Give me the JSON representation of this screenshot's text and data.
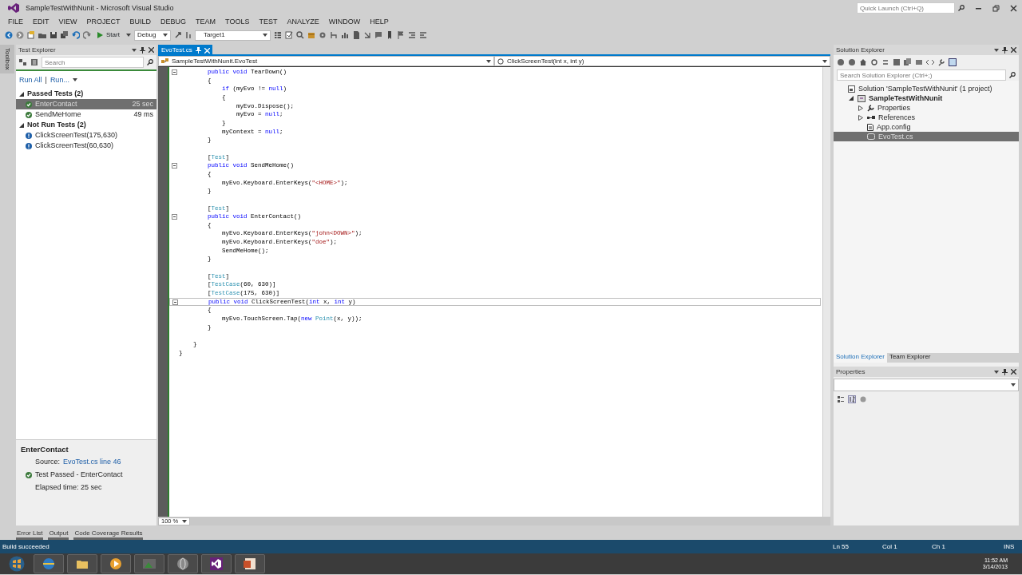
{
  "window": {
    "title": "SampleTestWithNunit - Microsoft Visual Studio",
    "quick_launch": {
      "placeholder": "Quick Launch (Ctrl+Q)"
    }
  },
  "menu": [
    "FILE",
    "EDIT",
    "VIEW",
    "PROJECT",
    "BUILD",
    "DEBUG",
    "TEAM",
    "TOOLS",
    "TEST",
    "ANALYZE",
    "WINDOW",
    "HELP"
  ],
  "toolbar": {
    "start_label": "Start",
    "configuration": "Debug",
    "target": "Target1"
  },
  "toolbox_tab": "Toolbox",
  "test_explorer": {
    "title": "Test Explorer",
    "search": {
      "placeholder": "Search"
    },
    "run_all": "Run All",
    "run_separator": "|",
    "run": "Run...",
    "groups": [
      {
        "label": "Passed Tests (2)",
        "expanded": true,
        "tests": [
          {
            "name": "EnterContact",
            "duration": "25 sec",
            "kind": "passed",
            "selected": true
          },
          {
            "name": "SendMeHome",
            "duration": "49 ms",
            "kind": "passed",
            "selected": false
          }
        ]
      },
      {
        "label": "Not Run Tests (2)",
        "expanded": true,
        "tests": [
          {
            "name": "ClickScreenTest(175,630)",
            "kind": "not_run",
            "selected": false
          },
          {
            "name": "ClickScreenTest(60,630)",
            "kind": "not_run",
            "selected": false
          }
        ]
      }
    ],
    "detail": {
      "title": "EnterContact",
      "source_label": "Source:",
      "source_link": "EvoTest.cs line 46",
      "result": "Test Passed - EnterContact",
      "kind": "passed",
      "elapsed": "Elapsed time: 25 sec"
    }
  },
  "editor": {
    "tabs": [
      {
        "label": "EvoTest.cs",
        "selected": true
      }
    ],
    "type_dropdown": "SampleTestWithNunit.EvoTest",
    "member_dropdown": "ClickScreenTest(int x, int y)",
    "zoom": "100 %",
    "code_lines": [
      {
        "kind": "code",
        "foldable": true,
        "segments": [
          {
            "text": "        public void",
            "kind": "keyword"
          },
          {
            "text": " TearDown()",
            "kind": "plain"
          }
        ]
      },
      {
        "kind": "code",
        "segments": [
          {
            "text": "        {",
            "kind": "plain"
          }
        ]
      },
      {
        "kind": "code",
        "segments": [
          {
            "text": "            if",
            "kind": "keyword"
          },
          {
            "text": " (myEvo != ",
            "kind": "plain"
          },
          {
            "text": "null",
            "kind": "keyword"
          },
          {
            "text": ")",
            "kind": "plain"
          }
        ]
      },
      {
        "kind": "code",
        "segments": [
          {
            "text": "            {",
            "kind": "plain"
          }
        ]
      },
      {
        "kind": "code",
        "segments": [
          {
            "text": "                myEvo.Dispose();",
            "kind": "plain"
          }
        ]
      },
      {
        "kind": "code",
        "segments": [
          {
            "text": "                myEvo = ",
            "kind": "plain"
          },
          {
            "text": "null",
            "kind": "keyword"
          },
          {
            "text": ";",
            "kind": "plain"
          }
        ]
      },
      {
        "kind": "code",
        "segments": [
          {
            "text": "            }",
            "kind": "plain"
          }
        ]
      },
      {
        "kind": "code",
        "segments": [
          {
            "text": "            myContext = ",
            "kind": "plain"
          },
          {
            "text": "null",
            "kind": "keyword"
          },
          {
            "text": ";",
            "kind": "plain"
          }
        ]
      },
      {
        "kind": "code",
        "segments": [
          {
            "text": "        }",
            "kind": "plain"
          }
        ]
      },
      {
        "kind": "blank"
      },
      {
        "kind": "code",
        "segments": [
          {
            "text": "        [",
            "kind": "plain"
          },
          {
            "text": "Test",
            "kind": "type"
          },
          {
            "text": "]",
            "kind": "plain"
          }
        ]
      },
      {
        "kind": "code",
        "foldable": true,
        "segments": [
          {
            "text": "        public void",
            "kind": "keyword"
          },
          {
            "text": " SendMeHome()",
            "kind": "plain"
          }
        ]
      },
      {
        "kind": "code",
        "segments": [
          {
            "text": "        {",
            "kind": "plain"
          }
        ]
      },
      {
        "kind": "code",
        "segments": [
          {
            "text": "            myEvo.Keyboard.EnterKeys(",
            "kind": "plain"
          },
          {
            "text": "\"<HOME>\"",
            "kind": "string"
          },
          {
            "text": ");",
            "kind": "plain"
          }
        ]
      },
      {
        "kind": "code",
        "segments": [
          {
            "text": "        }",
            "kind": "plain"
          }
        ]
      },
      {
        "kind": "blank"
      },
      {
        "kind": "code",
        "segments": [
          {
            "text": "        [",
            "kind": "plain"
          },
          {
            "text": "Test",
            "kind": "type"
          },
          {
            "text": "]",
            "kind": "plain"
          }
        ]
      },
      {
        "kind": "code",
        "foldable": true,
        "segments": [
          {
            "text": "        public void",
            "kind": "keyword"
          },
          {
            "text": " EnterContact()",
            "kind": "plain"
          }
        ]
      },
      {
        "kind": "code",
        "segments": [
          {
            "text": "        {",
            "kind": "plain"
          }
        ]
      },
      {
        "kind": "code",
        "segments": [
          {
            "text": "            myEvo.Keyboard.EnterKeys(",
            "kind": "plain"
          },
          {
            "text": "\"john<DOWN>\"",
            "kind": "string"
          },
          {
            "text": ");",
            "kind": "plain"
          }
        ]
      },
      {
        "kind": "code",
        "segments": [
          {
            "text": "            myEvo.Keyboard.EnterKeys(",
            "kind": "plain"
          },
          {
            "text": "\"doe\"",
            "kind": "string"
          },
          {
            "text": ");",
            "kind": "plain"
          }
        ]
      },
      {
        "kind": "code",
        "segments": [
          {
            "text": "            SendMeHome();",
            "kind": "plain"
          }
        ]
      },
      {
        "kind": "code",
        "segments": [
          {
            "text": "        }",
            "kind": "plain"
          }
        ]
      },
      {
        "kind": "blank"
      },
      {
        "kind": "code",
        "segments": [
          {
            "text": "        [",
            "kind": "plain"
          },
          {
            "text": "Test",
            "kind": "type"
          },
          {
            "text": "]",
            "kind": "plain"
          }
        ]
      },
      {
        "kind": "code",
        "segments": [
          {
            "text": "        [",
            "kind": "plain"
          },
          {
            "text": "TestCase",
            "kind": "type"
          },
          {
            "text": "(60, 630)]",
            "kind": "plain"
          }
        ]
      },
      {
        "kind": "code",
        "segments": [
          {
            "text": "        [",
            "kind": "plain"
          },
          {
            "text": "TestCase",
            "kind": "type"
          },
          {
            "text": "(175, 630)]",
            "kind": "plain"
          }
        ]
      },
      {
        "kind": "code",
        "foldable": true,
        "current": true,
        "segments": [
          {
            "text": "        public void",
            "kind": "keyword"
          },
          {
            "text": " ClickScreenTest(",
            "kind": "plain"
          },
          {
            "text": "int",
            "kind": "keyword"
          },
          {
            "text": " x, ",
            "kind": "plain"
          },
          {
            "text": "int",
            "kind": "keyword"
          },
          {
            "text": " y)",
            "kind": "plain"
          }
        ]
      },
      {
        "kind": "code",
        "segments": [
          {
            "text": "        {",
            "kind": "plain"
          }
        ]
      },
      {
        "kind": "code",
        "segments": [
          {
            "text": "            myEvo.TouchScreen.Tap(",
            "kind": "plain"
          },
          {
            "text": "new",
            "kind": "keyword"
          },
          {
            "text": " Point",
            "kind": "type"
          },
          {
            "text": "(x, y));",
            "kind": "plain"
          }
        ]
      },
      {
        "kind": "code",
        "segments": [
          {
            "text": "        }",
            "kind": "plain"
          }
        ]
      },
      {
        "kind": "blank"
      },
      {
        "kind": "code",
        "segments": [
          {
            "text": "    }",
            "kind": "plain"
          }
        ]
      },
      {
        "kind": "code",
        "segments": [
          {
            "text": "}",
            "kind": "plain"
          }
        ]
      }
    ]
  },
  "solution_explorer": {
    "title": "Solution Explorer",
    "search": {
      "placeholder": "Search Solution Explorer (Ctrl+;)"
    },
    "tree": [
      {
        "label": "Solution 'SampleTestWithNunit' (1 project)",
        "kind": "solution",
        "selected": false,
        "children": [
          {
            "label": "SampleTestWithNunit",
            "kind": "project",
            "expanded": true,
            "selected": false,
            "children": [
              {
                "label": "Properties",
                "kind": "properties",
                "expanded": false,
                "selected": false
              },
              {
                "label": "References",
                "kind": "references",
                "expanded": false,
                "selected": false
              },
              {
                "label": "App.config",
                "kind": "config",
                "selected": false
              },
              {
                "label": "EvoTest.cs",
                "kind": "csharp",
                "selected": true
              }
            ]
          }
        ]
      }
    ],
    "tabs": [
      {
        "label": "Solution Explorer",
        "selected": true
      },
      {
        "label": "Team Explorer",
        "selected": false
      }
    ]
  },
  "properties": {
    "title": "Properties"
  },
  "bottom_tabs": [
    {
      "label": "Error List"
    },
    {
      "label": "Output"
    },
    {
      "label": "Code Coverage Results"
    }
  ],
  "status_bar": {
    "message": "Build succeeded",
    "line": "Ln 55",
    "column": "Col 1",
    "char": "Ch 1",
    "mode": "INS"
  },
  "taskbar": {
    "time": "11:52 AM",
    "date": "3/14/2013"
  }
}
